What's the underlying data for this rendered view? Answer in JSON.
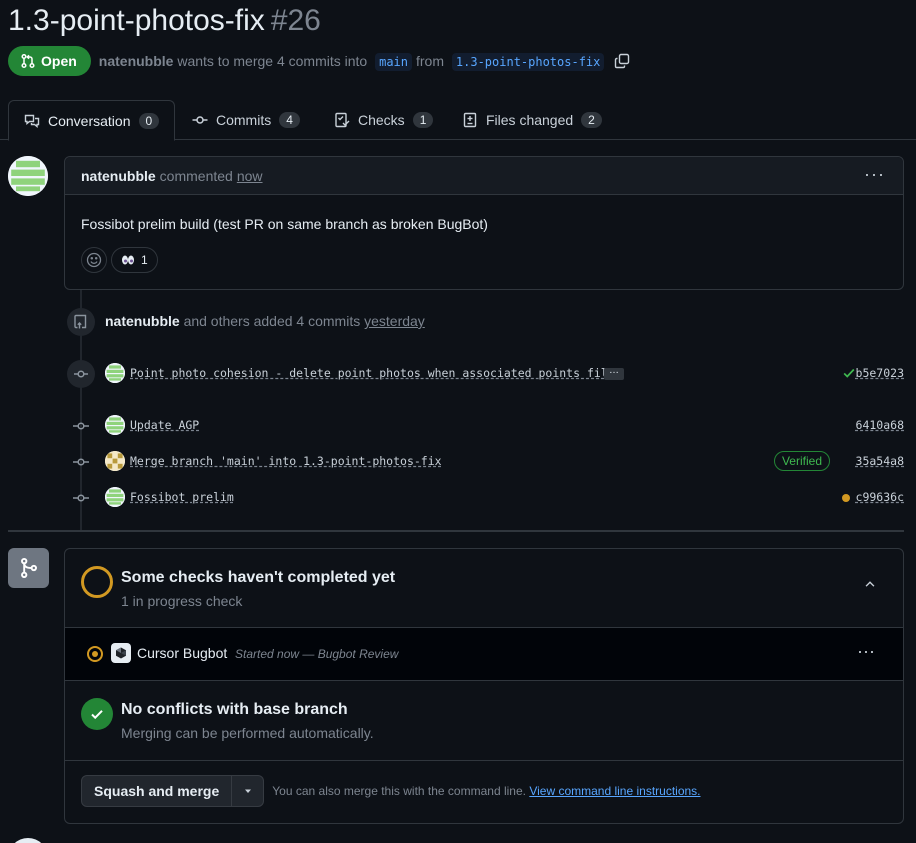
{
  "pr": {
    "title": "1.3-point-photos-fix",
    "number": "#26",
    "state": "Open",
    "author": "natenubble",
    "merge_text": "wants to merge 4 commits into",
    "base_branch": "main",
    "from_text": "from",
    "head_branch": "1.3-point-photos-fix"
  },
  "tabs": [
    {
      "label": "Conversation",
      "count": "0"
    },
    {
      "label": "Commits",
      "count": "4"
    },
    {
      "label": "Checks",
      "count": "1"
    },
    {
      "label": "Files changed",
      "count": "2"
    }
  ],
  "comment": {
    "author": "natenubble",
    "action": "commented",
    "time": "now",
    "body": "Fossibot prelim build (test PR on same branch as broken BugBot)",
    "reaction_count": "1"
  },
  "push_event": {
    "author": "natenubble",
    "text": "and others added 4 commits",
    "time": "yesterday"
  },
  "commits": [
    {
      "message": "Point photo cohesion - delete point photos when associated points fil…",
      "sha": "b5e7023",
      "status": "success"
    },
    {
      "message": "Update AGP",
      "sha": "6410a68",
      "status": "none"
    },
    {
      "message": "Merge branch 'main' into 1.3-point-photos-fix",
      "sha": "35a54a8",
      "status": "verified",
      "badge": "Verified"
    },
    {
      "message": "Fossibot prelim",
      "sha": "c99636c",
      "status": "pending"
    }
  ],
  "checks": {
    "title": "Some checks haven't completed yet",
    "subtitle": "1 in progress check",
    "items": [
      {
        "name": "Cursor Bugbot",
        "description": "Started now — Bugbot Review"
      }
    ]
  },
  "conflicts": {
    "title": "No conflicts with base branch",
    "subtitle": "Merging can be performed automatically."
  },
  "merge": {
    "button_label": "Squash and merge",
    "note": "You can also merge this with the command line.",
    "link": "View command line instructions."
  },
  "colors": {
    "background": "#0d1117",
    "open_green": "#238636",
    "pending_yellow": "#d29922",
    "link_blue": "#58a6ff"
  }
}
